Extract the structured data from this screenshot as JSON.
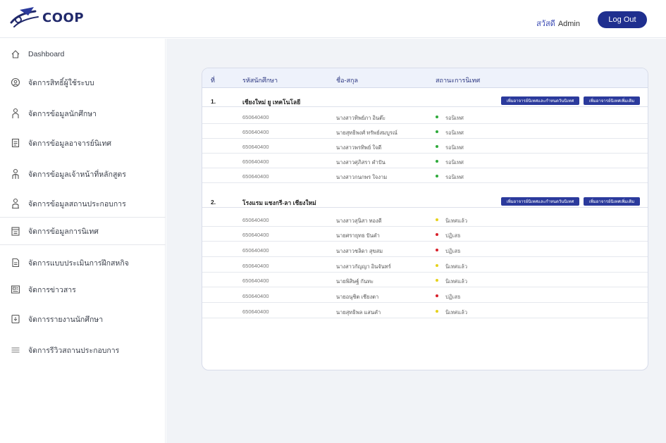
{
  "app": {
    "brand": "COOP"
  },
  "header": {
    "greeting": "สวัสดี",
    "user": "Admin",
    "logout_label": "Log Out"
  },
  "sidebar": {
    "items": [
      {
        "label": "Dashboard",
        "icon": "home-icon"
      },
      {
        "label": "จัดการสิทธิ์ผู้ใช้ระบบ",
        "icon": "user-settings-icon"
      },
      {
        "label": "จัดการข้อมูลนักศึกษา",
        "icon": "student-icon"
      },
      {
        "label": "จัดการข้อมูลอาจารย์นิเทศ",
        "icon": "document-icon"
      },
      {
        "label": "จัดการข้อมูลเจ้าหน้าที่หลักสูตร",
        "icon": "staff-icon"
      },
      {
        "label": "จัดการข้อมูลสถานประกอบการ",
        "icon": "company-icon"
      },
      {
        "label": "จัดการข้อมูลการนิเทศ",
        "icon": "clipboard-icon",
        "active": true
      },
      {
        "label": "จัดการแบบประเมินการฝึกสหกิจ",
        "icon": "form-icon"
      },
      {
        "label": "จัดการข่าวสาร",
        "icon": "news-icon"
      },
      {
        "label": "จัดการรายงานนักศึกษา",
        "icon": "report-icon"
      },
      {
        "label": "จัดการรีวิวสถานประกอบการ",
        "icon": "list-icon"
      }
    ]
  },
  "table": {
    "headers": {
      "no": "ที่",
      "student_id": "รหัสนักศึกษา",
      "name": "ชื่อ-สกุล",
      "status": "สถานะการนิเทศ"
    },
    "groups": [
      {
        "no": "1.",
        "name": "เชียงใหม่ ยู เทคโนโลยี",
        "btn_primary": "เพิ่มอาจารย์นิเทศและกำหนดวันนิเทศ",
        "btn_secondary": "เพิ่มอาจารย์นิเทศเพิ่มเติม",
        "rows": [
          {
            "id": "650640400",
            "name": "นางสาวทิพย์ภา อินต๊ะ",
            "status": "รอนิเทศ",
            "color": "#2eaa3a"
          },
          {
            "id": "650640400",
            "name": "นายสุทธิพงศ์ ทรัพย์สมบูรณ์",
            "status": "รอนิเทศ",
            "color": "#2eaa3a"
          },
          {
            "id": "650640400",
            "name": "นางสาวพรทิพย์ ใจดี",
            "status": "รอนิเทศ",
            "color": "#2eaa3a"
          },
          {
            "id": "650640400",
            "name": "นางสาวศุภิสรา คำปัน",
            "status": "รอนิเทศ",
            "color": "#2eaa3a"
          },
          {
            "id": "650640400",
            "name": "นางสาวกนกพร ใจงาม",
            "status": "รอนิเทศ",
            "color": "#2eaa3a"
          }
        ]
      },
      {
        "no": "2.",
        "name": "โรงแรม แชงกรี-ลา เชียงใหม่",
        "btn_primary": "เพิ่มอาจารย์นิเทศและกำหนดวันนิเทศ",
        "btn_secondary": "เพิ่มอาจารย์นิเทศเพิ่มเติม",
        "rows": [
          {
            "id": "650640400",
            "name": "นางสาวสุนิสา ทองดี",
            "status": "นิเทศแล้ว",
            "color": "#e6d21c"
          },
          {
            "id": "650640400",
            "name": "นายศรายุทธ ปันคำ",
            "status": "ปฏิเสธ",
            "color": "#d8202a"
          },
          {
            "id": "650640400",
            "name": "นางสาวชลิดา สุขสม",
            "status": "ปฏิเสธ",
            "color": "#d8202a"
          },
          {
            "id": "650640400",
            "name": "นางสาวกัญญา อินจันทร์",
            "status": "นิเทศแล้ว",
            "color": "#e6d21c"
          },
          {
            "id": "650640400",
            "name": "นายพิสิษฐ์ กันทะ",
            "status": "นิเทศแล้ว",
            "color": "#e6d21c"
          },
          {
            "id": "650640400",
            "name": "นายอนุชิต เชียงตา",
            "status": "ปฏิเสธ",
            "color": "#d8202a"
          },
          {
            "id": "650640400",
            "name": "นายสุทธิพล แสนคำ",
            "status": "นิเทศแล้ว",
            "color": "#e6d21c"
          }
        ]
      }
    ]
  }
}
